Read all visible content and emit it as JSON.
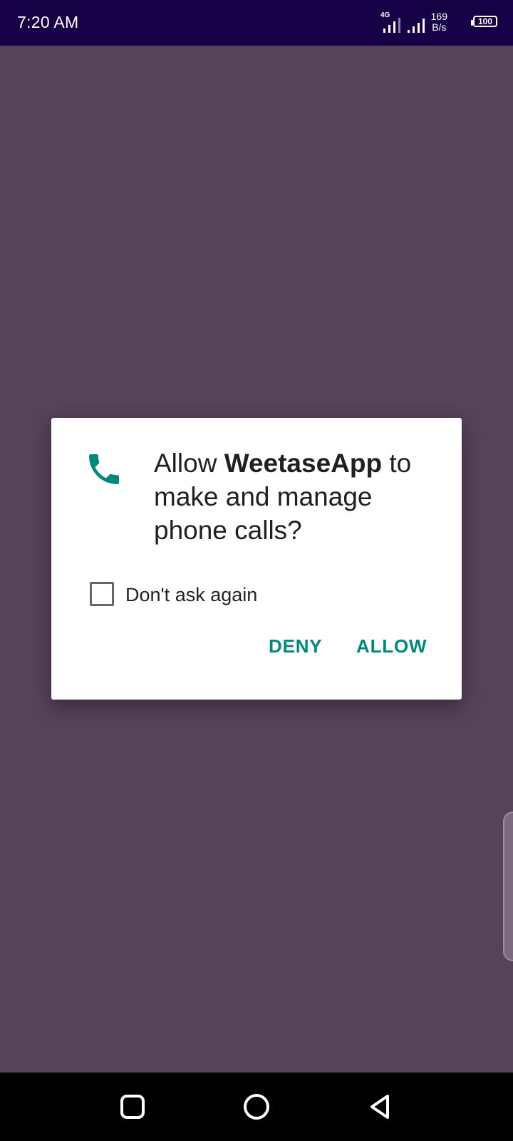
{
  "status_bar": {
    "time": "7:20 AM",
    "network_type": "4G",
    "speed_value": "169",
    "speed_unit": "B/s",
    "battery": "100",
    "background": "#160046"
  },
  "background_color": "#564259",
  "dialog": {
    "icon": "phone-icon",
    "icon_color": "#00897b",
    "title_prefix": "Allow ",
    "app_name": "WeetaseApp",
    "title_suffix": "to make and manage phone calls?",
    "checkbox_label": "Don't ask again",
    "checkbox_checked": false,
    "deny_label": "DENY",
    "allow_label": "ALLOW",
    "button_color": "#00897b"
  },
  "nav_bar": {
    "recents": "square-icon",
    "home": "circle-icon",
    "back": "triangle-back-icon"
  }
}
